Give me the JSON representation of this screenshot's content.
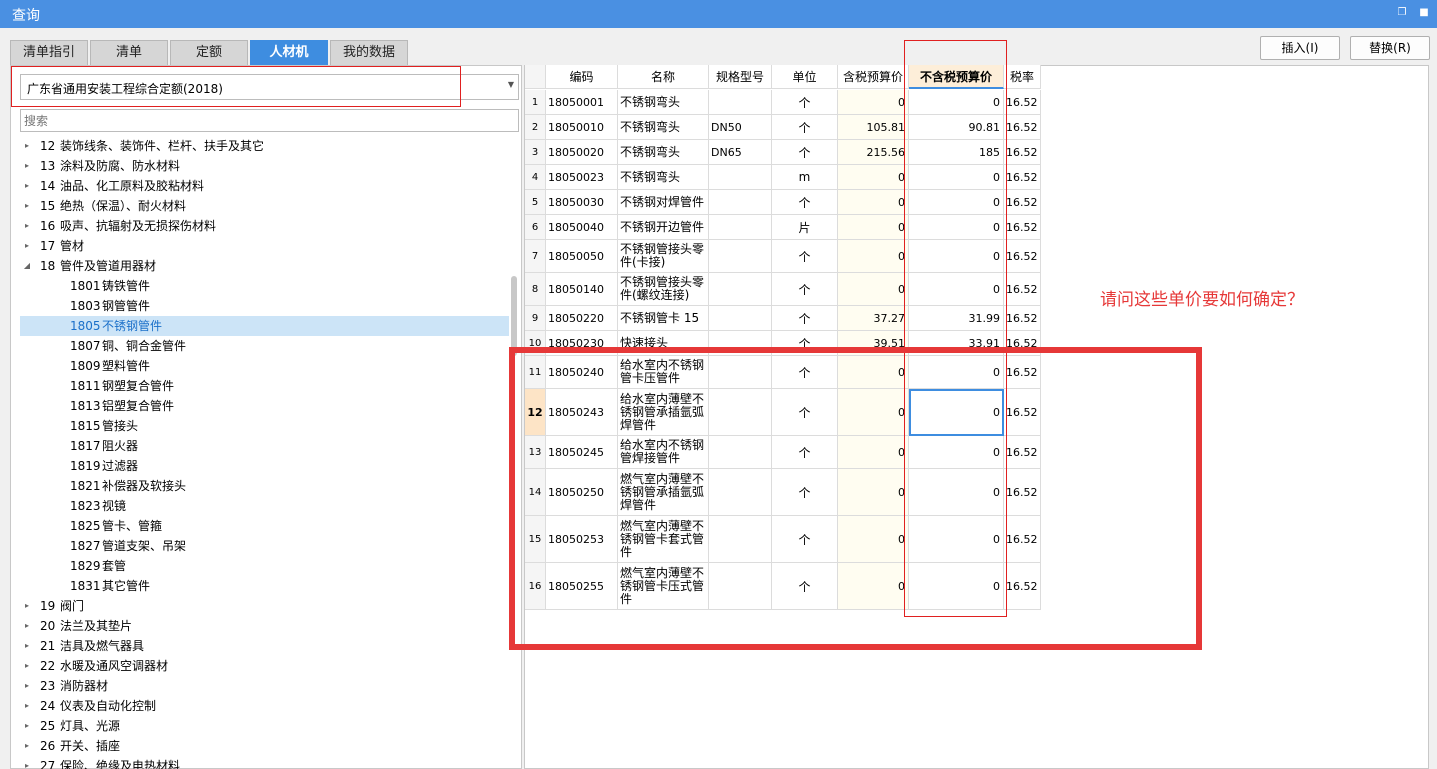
{
  "window": {
    "title": "查询"
  },
  "tabs": [
    {
      "label": "清单指引",
      "active": false
    },
    {
      "label": "清单",
      "active": false
    },
    {
      "label": "定额",
      "active": false
    },
    {
      "label": "人材机",
      "active": true
    },
    {
      "label": "我的数据",
      "active": false
    }
  ],
  "buttons": {
    "insert": "插入(I)",
    "replace": "替换(R)"
  },
  "left": {
    "quota_select": "广东省通用安装工程综合定额(2018)",
    "search_placeholder": "搜索",
    "tree": [
      {
        "code": "12",
        "label": "装饰线条、装饰件、栏杆、扶手及其它",
        "level": 0,
        "toggle": "▸"
      },
      {
        "code": "13",
        "label": "涂料及防腐、防水材料",
        "level": 0,
        "toggle": "▸"
      },
      {
        "code": "14",
        "label": "油品、化工原料及胶粘材料",
        "level": 0,
        "toggle": "▸"
      },
      {
        "code": "15",
        "label": "绝热（保温）、耐火材料",
        "level": 0,
        "toggle": "▸"
      },
      {
        "code": "16",
        "label": "吸声、抗辐射及无损探伤材料",
        "level": 0,
        "toggle": "▸"
      },
      {
        "code": "17",
        "label": "管材",
        "level": 0,
        "toggle": "▸"
      },
      {
        "code": "18",
        "label": "管件及管道用器材",
        "level": 0,
        "toggle": "◢"
      },
      {
        "code": "1801",
        "label": "铸铁管件",
        "level": 1,
        "toggle": ""
      },
      {
        "code": "1803",
        "label": "钢管管件",
        "level": 1,
        "toggle": ""
      },
      {
        "code": "1805",
        "label": "不锈钢管件",
        "level": 1,
        "toggle": "",
        "selected": true
      },
      {
        "code": "1807",
        "label": "铜、铜合金管件",
        "level": 1,
        "toggle": ""
      },
      {
        "code": "1809",
        "label": "塑料管件",
        "level": 1,
        "toggle": ""
      },
      {
        "code": "1811",
        "label": "钢塑复合管件",
        "level": 1,
        "toggle": ""
      },
      {
        "code": "1813",
        "label": "铝塑复合管件",
        "level": 1,
        "toggle": ""
      },
      {
        "code": "1815",
        "label": "管接头",
        "level": 1,
        "toggle": ""
      },
      {
        "code": "1817",
        "label": "阻火器",
        "level": 1,
        "toggle": ""
      },
      {
        "code": "1819",
        "label": "过滤器",
        "level": 1,
        "toggle": ""
      },
      {
        "code": "1821",
        "label": "补偿器及软接头",
        "level": 1,
        "toggle": ""
      },
      {
        "code": "1823",
        "label": "视镜",
        "level": 1,
        "toggle": ""
      },
      {
        "code": "1825",
        "label": "管卡、管箍",
        "level": 1,
        "toggle": ""
      },
      {
        "code": "1827",
        "label": "管道支架、吊架",
        "level": 1,
        "toggle": ""
      },
      {
        "code": "1829",
        "label": "套管",
        "level": 1,
        "toggle": ""
      },
      {
        "code": "1831",
        "label": "其它管件",
        "level": 1,
        "toggle": ""
      },
      {
        "code": "19",
        "label": "阀门",
        "level": 0,
        "toggle": "▸"
      },
      {
        "code": "20",
        "label": "法兰及其垫片",
        "level": 0,
        "toggle": "▸"
      },
      {
        "code": "21",
        "label": "洁具及燃气器具",
        "level": 0,
        "toggle": "▸"
      },
      {
        "code": "22",
        "label": "水暖及通风空调器材",
        "level": 0,
        "toggle": "▸"
      },
      {
        "code": "23",
        "label": "消防器材",
        "level": 0,
        "toggle": "▸"
      },
      {
        "code": "24",
        "label": "仪表及自动化控制",
        "level": 0,
        "toggle": "▸"
      },
      {
        "code": "25",
        "label": "灯具、光源",
        "level": 0,
        "toggle": "▸"
      },
      {
        "code": "26",
        "label": "开关、插座",
        "level": 0,
        "toggle": "▸"
      },
      {
        "code": "27",
        "label": "保险、绝缘及电热材料",
        "level": 0,
        "toggle": "▸"
      }
    ]
  },
  "grid": {
    "columns": [
      "",
      "编码",
      "名称",
      "规格型号",
      "单位",
      "含税预算价",
      "不含税预算价",
      "税率"
    ],
    "highlight_column": 6,
    "current_row": 12,
    "rows": [
      {
        "idx": "1",
        "code": "18050001",
        "name": "不锈钢弯头",
        "spec": "",
        "unit": "个",
        "price_tax": "0",
        "price_notax": "0",
        "tax": "16.52"
      },
      {
        "idx": "2",
        "code": "18050010",
        "name": "不锈钢弯头",
        "spec": "DN50",
        "unit": "个",
        "price_tax": "105.81",
        "price_notax": "90.81",
        "tax": "16.52"
      },
      {
        "idx": "3",
        "code": "18050020",
        "name": "不锈钢弯头",
        "spec": "DN65",
        "unit": "个",
        "price_tax": "215.56",
        "price_notax": "185",
        "tax": "16.52"
      },
      {
        "idx": "4",
        "code": "18050023",
        "name": "不锈钢弯头",
        "spec": "",
        "unit": "m",
        "price_tax": "0",
        "price_notax": "0",
        "tax": "16.52"
      },
      {
        "idx": "5",
        "code": "18050030",
        "name": "不锈钢对焊管件",
        "spec": "",
        "unit": "个",
        "price_tax": "0",
        "price_notax": "0",
        "tax": "16.52"
      },
      {
        "idx": "6",
        "code": "18050040",
        "name": "不锈钢开边管件",
        "spec": "",
        "unit": "片",
        "price_tax": "0",
        "price_notax": "0",
        "tax": "16.52"
      },
      {
        "idx": "7",
        "code": "18050050",
        "name": "不锈钢管接头零件(卡接)",
        "spec": "",
        "unit": "个",
        "price_tax": "0",
        "price_notax": "0",
        "tax": "16.52"
      },
      {
        "idx": "8",
        "code": "18050140",
        "name": "不锈钢管接头零件(螺纹连接)",
        "spec": "",
        "unit": "个",
        "price_tax": "0",
        "price_notax": "0",
        "tax": "16.52"
      },
      {
        "idx": "9",
        "code": "18050220",
        "name": "不锈钢管卡 15",
        "spec": "",
        "unit": "个",
        "price_tax": "37.27",
        "price_notax": "31.99",
        "tax": "16.52"
      },
      {
        "idx": "10",
        "code": "18050230",
        "name": "快速接头",
        "spec": "",
        "unit": "个",
        "price_tax": "39.51",
        "price_notax": "33.91",
        "tax": "16.52"
      },
      {
        "idx": "11",
        "code": "18050240",
        "name": "给水室内不锈钢管卡压管件",
        "spec": "",
        "unit": "个",
        "price_tax": "0",
        "price_notax": "0",
        "tax": "16.52"
      },
      {
        "idx": "12",
        "code": "18050243",
        "name": "给水室内薄壁不锈钢管承插氩弧焊管件",
        "spec": "",
        "unit": "个",
        "price_tax": "0",
        "price_notax": "0",
        "tax": "16.52"
      },
      {
        "idx": "13",
        "code": "18050245",
        "name": "给水室内不锈钢管焊接管件",
        "spec": "",
        "unit": "个",
        "price_tax": "0",
        "price_notax": "0",
        "tax": "16.52"
      },
      {
        "idx": "14",
        "code": "18050250",
        "name": "燃气室内薄壁不锈钢管承插氩弧焊管件",
        "spec": "",
        "unit": "个",
        "price_tax": "0",
        "price_notax": "0",
        "tax": "16.52"
      },
      {
        "idx": "15",
        "code": "18050253",
        "name": "燃气室内薄壁不锈钢管卡套式管件",
        "spec": "",
        "unit": "个",
        "price_tax": "0",
        "price_notax": "0",
        "tax": "16.52"
      },
      {
        "idx": "16",
        "code": "18050255",
        "name": "燃气室内薄壁不锈钢管卡压式管件",
        "spec": "",
        "unit": "个",
        "price_tax": "0",
        "price_notax": "0",
        "tax": "16.52"
      }
    ]
  },
  "annotation": {
    "question": "请问这些单价要如何确定？",
    "color": "#e63838"
  },
  "colors": {
    "titlebar": "#4a90e2",
    "active_tab": "#3e8de0",
    "selected_tree": "#cce4f7"
  },
  "icons": {
    "restore": "restore-icon",
    "close": "close-icon",
    "dropdown": "chevron-down-icon",
    "tree_toggle": "triangle-icon"
  }
}
